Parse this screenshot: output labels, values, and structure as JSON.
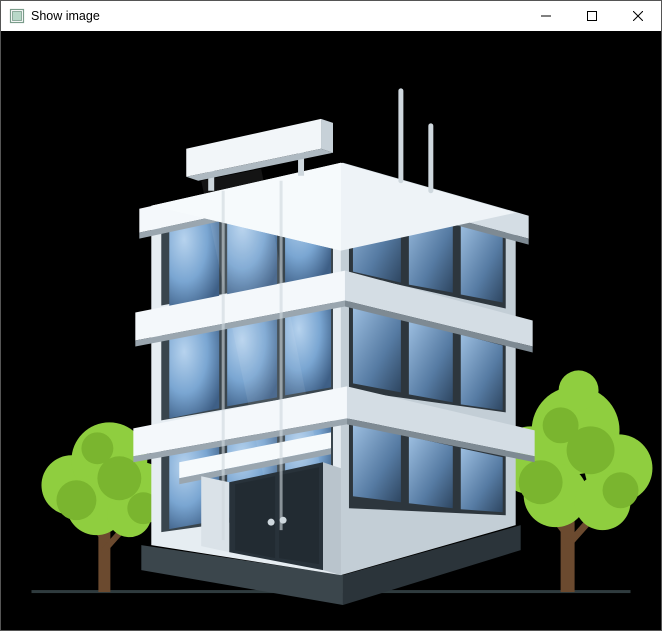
{
  "window": {
    "title": "Show image"
  },
  "controls": {
    "minimize_tooltip": "Minimize",
    "maximize_tooltip": "Maximize",
    "close_tooltip": "Close"
  },
  "image": {
    "description": "office-building-with-trees",
    "background_color": "#000000"
  }
}
